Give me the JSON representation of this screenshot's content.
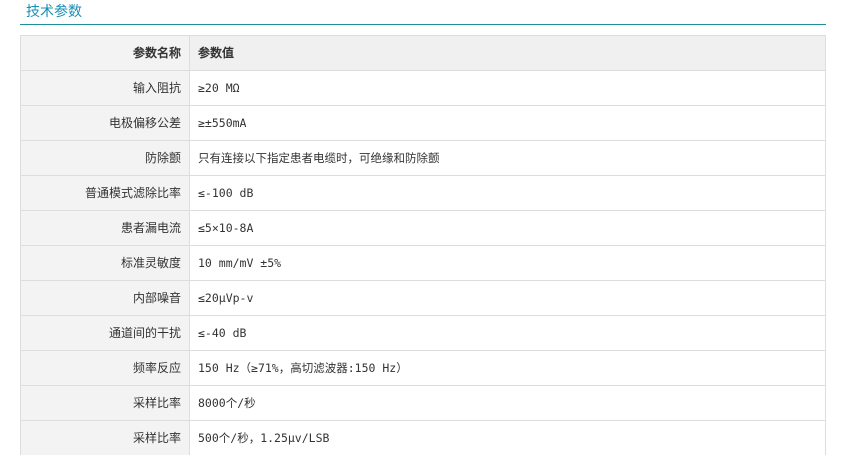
{
  "section": {
    "title": "技术参数"
  },
  "table": {
    "headers": {
      "name": "参数名称",
      "value": "参数值"
    },
    "rows": [
      {
        "name": "输入阻抗",
        "value": "≥20 MΩ"
      },
      {
        "name": "电极偏移公差",
        "value": "≥±550mA"
      },
      {
        "name": "防除颤",
        "value": "只有连接以下指定患者电缆时，可绝缘和防除颤"
      },
      {
        "name": "普通模式滤除比率",
        "value": "≤-100 dB"
      },
      {
        "name": "患者漏电流",
        "value": "≤5×10-8A"
      },
      {
        "name": "标准灵敏度",
        "value": "10 mm/mV ±5%"
      },
      {
        "name": "内部噪音",
        "value": "≤20μVp-v"
      },
      {
        "name": "通道间的干扰",
        "value": "≤-40 dB"
      },
      {
        "name": "频率反应",
        "value": "150 Hz（≥71%，高切滤波器:150 Hz）"
      },
      {
        "name": "采样比率",
        "value": "8000个/秒"
      },
      {
        "name": "采样比率",
        "value": "500个/秒，1.25μv/LSB"
      }
    ]
  }
}
